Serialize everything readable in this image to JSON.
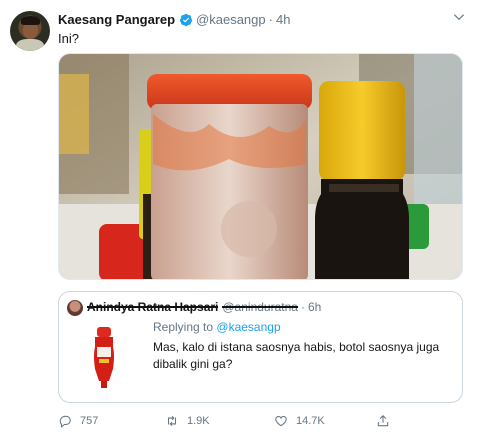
{
  "tweet": {
    "author_name": "Kaesang Pangarep",
    "author_handle": "@kaesangp",
    "separator": "·",
    "time": "4h",
    "text": "Ini?"
  },
  "quoted_tweet": {
    "author_name": "Anindya Ratna Hapsari",
    "author_handle": "@aninduratna",
    "separator": "·",
    "time": "6h",
    "replying_label": "Replying to",
    "replying_to": "@kaesangp",
    "text": "Mas, kalo di istana saosnya habis, botol saosnya juga dibalik gini ga?"
  },
  "actions": {
    "replies": "757",
    "retweets": "1.9K",
    "likes": "14.7K"
  },
  "icons": {
    "verified": "verified-badge-icon",
    "caret": "chevron-down-icon",
    "reply": "reply-icon",
    "retweet": "retweet-icon",
    "like": "heart-icon",
    "share": "share-icon"
  },
  "colors": {
    "accent": "#1da1f2",
    "secondary_text": "#657786",
    "border": "#ccd6dd"
  }
}
